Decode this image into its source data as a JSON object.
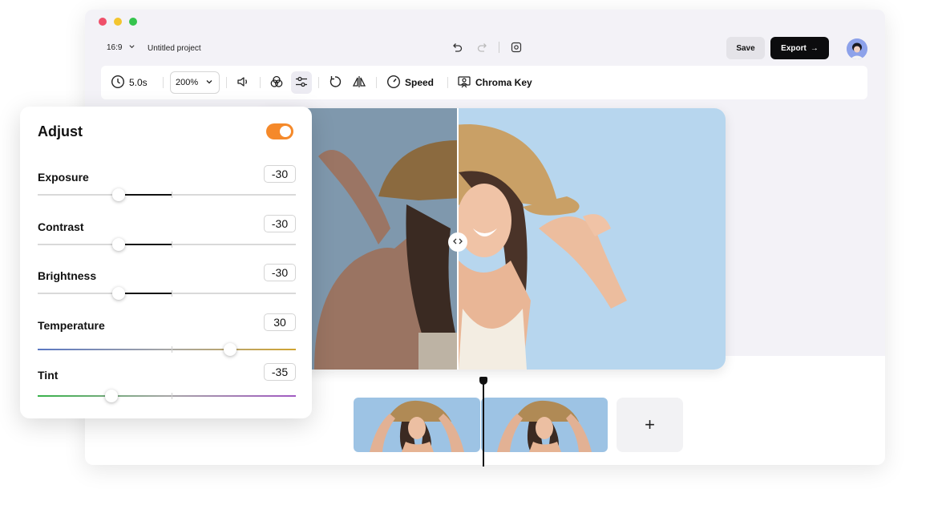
{
  "header": {
    "aspect_ratio": "16:9",
    "project_name": "Untitled project",
    "save_label": "Save",
    "export_label": "Export",
    "export_arrow": "→"
  },
  "toolbar": {
    "duration": "5.0s",
    "zoom": "200%",
    "speed_label": "Speed",
    "chroma_key_label": "Chroma Key",
    "icons": [
      "clock-icon",
      "volume-icon",
      "color-filter-icon",
      "adjust-sliders-icon",
      "rotate-icon",
      "flip-icon",
      "speed-icon",
      "chroma-key-icon"
    ]
  },
  "adjust": {
    "title": "Adjust",
    "enabled": true,
    "exposure": {
      "label": "Exposure",
      "value": "-30"
    },
    "contrast": {
      "label": "Contrast",
      "value": "-30"
    },
    "brightness": {
      "label": "Brightness",
      "value": "-30"
    },
    "temperature": {
      "label": "Temperature",
      "value": "30"
    },
    "tint": {
      "label": "Tint",
      "value": "-35"
    }
  },
  "timeline": {
    "add_label": "+"
  },
  "colors": {
    "accent_toggle": "#f5892a",
    "export_bg": "#0c0c0e",
    "mac_red": "#ef4f6a",
    "mac_yellow": "#f3c52f",
    "mac_green": "#35c44d"
  }
}
